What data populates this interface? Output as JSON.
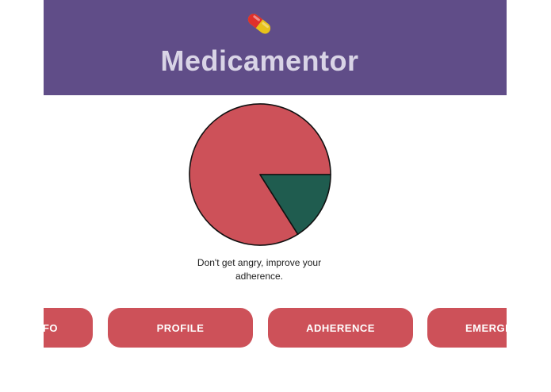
{
  "header": {
    "title": "Medicamentor",
    "logo_icon": "pill-capsule-icon",
    "background_color": "#604d88"
  },
  "chart_data": {
    "type": "pie",
    "title": "",
    "slices": [
      {
        "value": 84,
        "color": "#cd5159"
      },
      {
        "value": 16,
        "color": "#1f5c4f"
      }
    ]
  },
  "message": {
    "text": "Don't get angry, improve your adherence."
  },
  "nav": {
    "buttons": [
      {
        "label": "FO"
      },
      {
        "label": "PROFILE"
      },
      {
        "label": "ADHERENCE"
      },
      {
        "label": "EMERGE"
      }
    ],
    "button_color": "#cd5159"
  }
}
